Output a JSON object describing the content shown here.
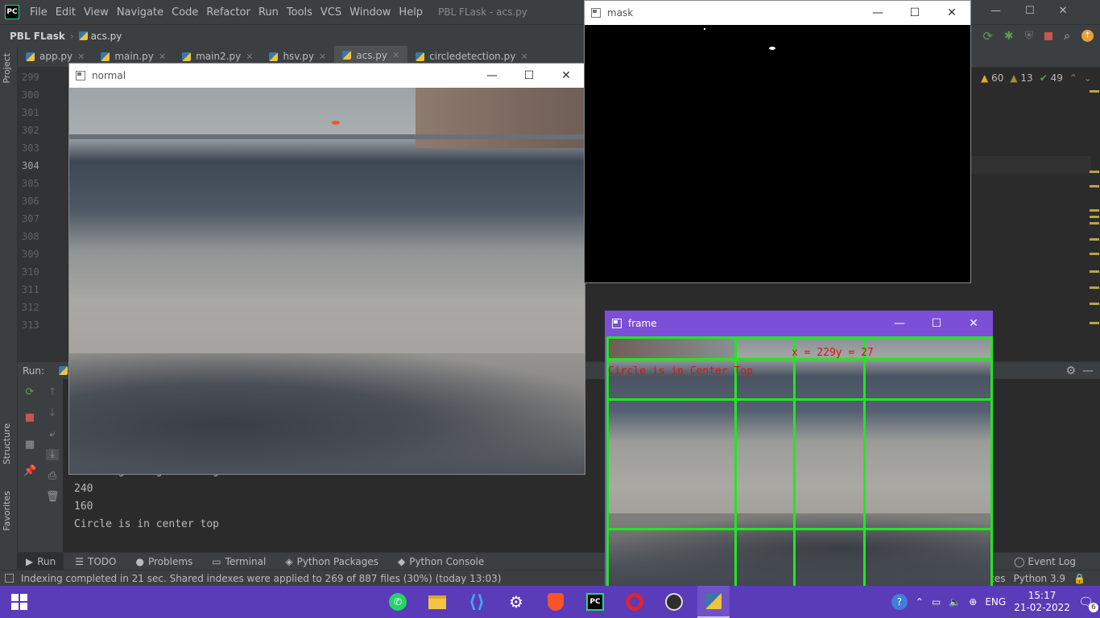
{
  "ide": {
    "logo": "PC",
    "menu": [
      "File",
      "Edit",
      "View",
      "Navigate",
      "Code",
      "Refactor",
      "Run",
      "Tools",
      "VCS",
      "Window",
      "Help"
    ],
    "title": "PBL FLask - acs.py",
    "project_name": "PBL FLask",
    "breadcrumb_file": "acs.py",
    "tabs": [
      {
        "label": "app.py"
      },
      {
        "label": "main.py"
      },
      {
        "label": "main2.py"
      },
      {
        "label": "hsv.py"
      },
      {
        "label": "acs.py"
      },
      {
        "label": "circledetection.py"
      }
    ],
    "side_labels": {
      "project": "Project",
      "structure": "Structure",
      "favorites": "Favorites"
    },
    "line_numbers": [
      "299",
      "300",
      "301",
      "302",
      "303",
      "304",
      "305",
      "306",
      "307",
      "308",
      "309",
      "310",
      "311",
      "312",
      "313"
    ],
    "inspections": {
      "warnings": "60",
      "weak": "13",
      "ok": "49"
    },
    "run_label": "Run:",
    "console_lines": [
      "Starting navigation Algorithm ...",
      "240",
      "160",
      "Circle is in center top"
    ],
    "bottom_tabs": [
      "Run",
      "TODO",
      "Problems",
      "Terminal",
      "Python Packages",
      "Python Console"
    ],
    "event_log": "Event Log",
    "status": "Indexing completed in 21 sec. Shared indexes were applied to 269 of 887 files (30%) (today 13:03)",
    "status_right": [
      "paces",
      "Python 3.9"
    ]
  },
  "windows": {
    "normal": {
      "title": "normal"
    },
    "mask": {
      "title": "mask"
    },
    "frame": {
      "title": "frame",
      "coord_text": "x = 229y = 27",
      "position_text": "Circle is in Center Top"
    }
  },
  "window_controls": {
    "minimize": "—",
    "maximize": "☐",
    "close": "✕"
  },
  "taskbar": {
    "apps": [
      "whatsapp-icon",
      "files-icon",
      "vscode-icon",
      "settings-icon",
      "brave-icon",
      "pycharm-icon",
      "opera-icon",
      "obs-icon",
      "python-icon"
    ],
    "lang": "ENG",
    "time": "15:17",
    "date": "21-02-2022",
    "notifications": "6"
  },
  "colors": {
    "ide_bg": "#2b2b2b",
    "ide_panel": "#3c3f41",
    "taskbar": "#5a3bb8",
    "frame_titlebar": "#7b4fd6",
    "grid_green": "#22e622",
    "overlay_red": "#e01010"
  }
}
